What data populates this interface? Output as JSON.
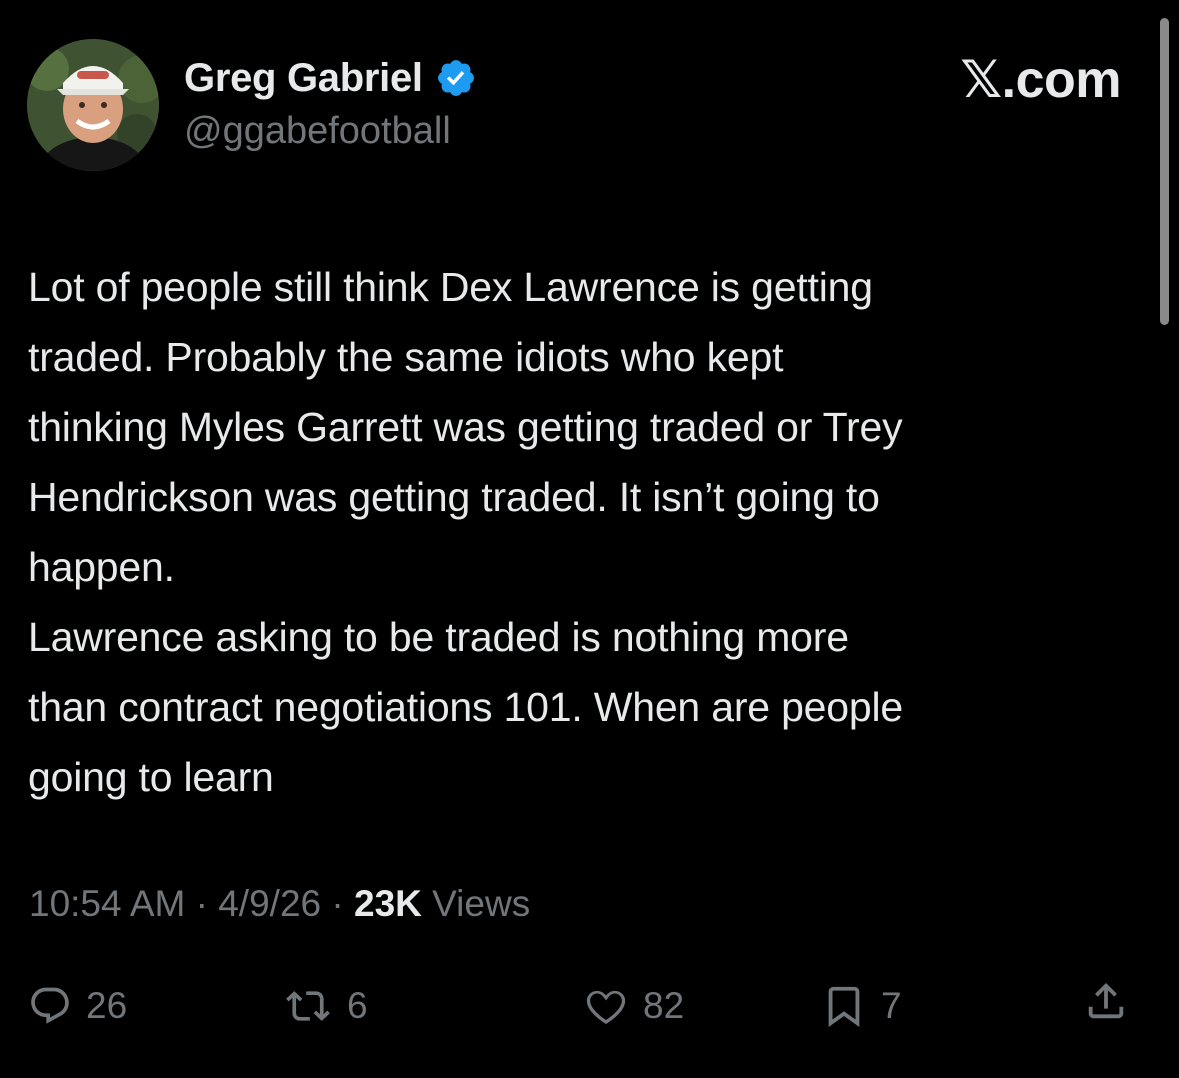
{
  "author": {
    "name": "Greg Gabriel",
    "handle": "@ggabefootball",
    "verified_icon": "verified-badge-icon",
    "verified_color": "#1d9bf0"
  },
  "brand": "𝕏.com",
  "tweet": {
    "text": "Lot of people still think Dex Lawrence is getting\ntraded. Probably the same idiots who kept\nthinking Myles Garrett was getting traded or Trey\nHendrickson was getting traded. It isn’t going to\nhappen.\nLawrence asking to be traded is nothing more\nthan contract negotiations 101. When are people\ngoing to learn"
  },
  "meta": {
    "time": "10:54 AM",
    "sep1": " · ",
    "date": "4/9/26",
    "sep2": " · ",
    "views_count": "23K",
    "views_label": " Views"
  },
  "actions": {
    "reply": {
      "icon": "reply-icon",
      "count": "26"
    },
    "repost": {
      "icon": "repost-icon",
      "count": "6"
    },
    "like": {
      "icon": "like-icon",
      "count": "82"
    },
    "bookmark": {
      "icon": "bookmark-icon",
      "count": "7"
    },
    "share": {
      "icon": "share-icon"
    }
  },
  "colors": {
    "background": "#000000",
    "primary_text": "#e7e9ea",
    "secondary_text": "#71767b"
  }
}
